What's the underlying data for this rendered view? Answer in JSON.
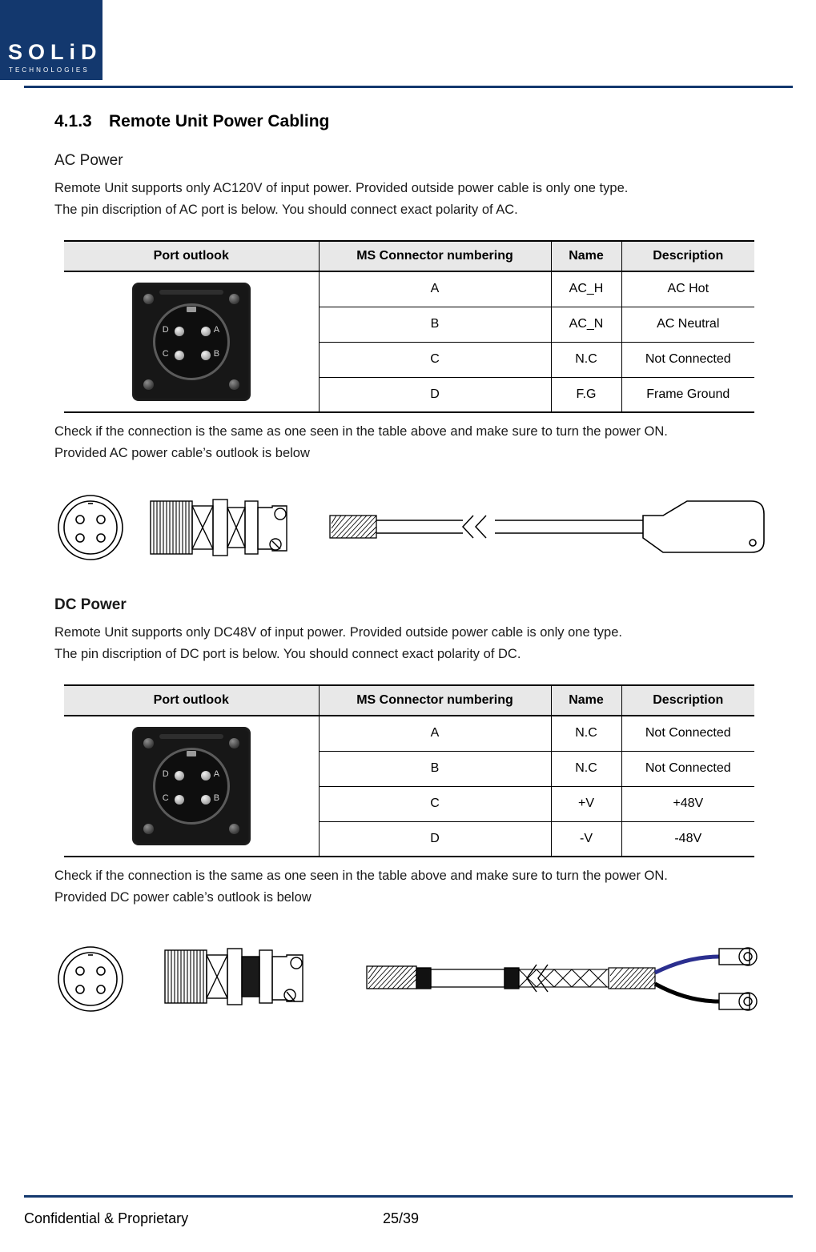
{
  "header": {
    "logo_text": "SOLiD",
    "logo_sub": "TECHNOLOGIES"
  },
  "section": {
    "number": "4.1.3",
    "title": "Remote Unit Power Cabling"
  },
  "ac": {
    "heading": "AC Power",
    "para1": "Remote Unit supports only AC120V of input power. Provided outside power cable is only one type.",
    "para2": "The pin discription of AC port is below. You should connect exact polarity of AC.",
    "table": {
      "headers": [
        "Port outlook",
        "MS Connector numbering",
        "Name",
        "Description"
      ],
      "rows": [
        [
          "A",
          "AC_H",
          "AC Hot"
        ],
        [
          "B",
          "AC_N",
          "AC Neutral"
        ],
        [
          "C",
          "N.C",
          "Not Connected"
        ],
        [
          "D",
          "F.G",
          "Frame Ground"
        ]
      ],
      "port_pins": [
        "D",
        "A",
        "C",
        "B"
      ]
    },
    "note1": "Check if the connection is the same as one seen in the table above and make sure to turn the power ON.",
    "note2": "Provided AC power cable’s outlook is below"
  },
  "dc": {
    "heading": "DC Power",
    "para1": "Remote Unit supports only DC48V of input power. Provided outside power cable is only one type.",
    "para2": "The pin discription of DC port is below. You should connect exact polarity of DC.",
    "table": {
      "headers": [
        "Port outlook",
        "MS Connector numbering",
        "Name",
        "Description"
      ],
      "rows": [
        [
          "A",
          "N.C",
          "Not Connected"
        ],
        [
          "B",
          "N.C",
          "Not Connected"
        ],
        [
          "C",
          "+V",
          "+48V"
        ],
        [
          "D",
          "-V",
          "-48V"
        ]
      ],
      "port_pins": [
        "D",
        "A",
        "C",
        "B"
      ]
    },
    "note1": "Check if the connection is the same as one seen in the table above and make sure to turn the power ON.",
    "note2": "Provided DC power cable’s outlook is below"
  },
  "footer": {
    "left": "Confidential & Proprietary",
    "center": "25/39"
  },
  "colors": {
    "brand": "#13386e",
    "table_header_bg": "#e8e8e8",
    "dc_wire_positive": "#2b2f8f",
    "dc_wire_negative": "#000000"
  }
}
